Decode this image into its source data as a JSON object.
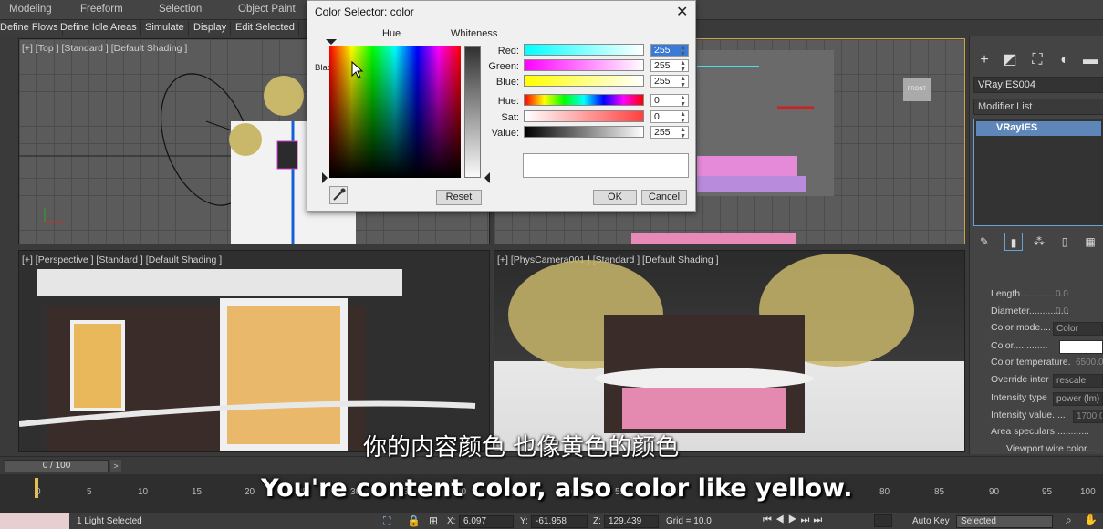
{
  "ribbon": {
    "tabs": [
      "Modeling",
      "Freeform",
      "Selection",
      "Object Paint"
    ],
    "buttons": [
      "Define Flows",
      "Define Idle Areas",
      "Simulate",
      "Display",
      "Edit Selected"
    ]
  },
  "viewports": {
    "top": "[+] [Top ] [Standard ] [Default Shading ]",
    "perspective": "[+] [Perspective ] [Standard ] [Default Shading ]",
    "camera": "[+] [PhysCamera001 ] [Standard ] [Default Shading ]",
    "viewcube_front": "FRONT"
  },
  "dialog": {
    "title": "Color Selector: color",
    "hue_label": "Hue",
    "whiteness_label": "Whiteness",
    "blackness_label": "Blackness",
    "sliders": [
      {
        "label": "Red:",
        "value": "255",
        "selected": true
      },
      {
        "label": "Green:",
        "value": "255"
      },
      {
        "label": "Blue:",
        "value": "255"
      },
      {
        "label": "Hue:",
        "value": "0"
      },
      {
        "label": "Sat:",
        "value": "0"
      },
      {
        "label": "Value:",
        "value": "255"
      }
    ],
    "reset_label": "Reset",
    "ok_label": "OK",
    "cancel_label": "Cancel",
    "current_color": "#ffffff"
  },
  "command_panel": {
    "object_name": "VRayIES004",
    "modifier_list": "Modifier List",
    "stack_item": "VRayIES",
    "params": [
      {
        "label": "Length.................",
        "value": "0.0"
      },
      {
        "label": "Diameter...............",
        "value": "0.0"
      },
      {
        "label": "Color mode....",
        "value": "Color"
      },
      {
        "label": "Color.............",
        "value": ""
      },
      {
        "label": "Color temperature.",
        "value": "6500.0"
      },
      {
        "label": "Override inter",
        "value": "rescale"
      },
      {
        "label": "Intensity type",
        "value": "power (lm)"
      },
      {
        "label": "Intensity value.....",
        "value": "1700.0"
      },
      {
        "label": "Area speculars.............",
        "value": ""
      },
      {
        "label": "Viewport wire color.....",
        "value": ""
      }
    ]
  },
  "timeline": {
    "frame": "0 / 100",
    "next": ">",
    "ticks": [
      "0",
      "5",
      "10",
      "15",
      "20",
      "25",
      "30",
      "35",
      "40",
      "45",
      "50",
      "55",
      "60",
      "65",
      "70",
      "75",
      "80",
      "85",
      "90",
      "95",
      "100"
    ]
  },
  "status": {
    "selection": "1 Light Selected",
    "x_label": "X:",
    "x": "6.097",
    "y_label": "Y:",
    "y": "-61.958",
    "z_label": "Z:",
    "z": "129.439",
    "grid": "Grid = 10.0",
    "auto_key": "Auto Key",
    "selected": "Selected"
  },
  "subtitles": {
    "chinese": "你的内容颜色 也像黄色的颜色",
    "english": "You're content color, also color like yellow."
  }
}
